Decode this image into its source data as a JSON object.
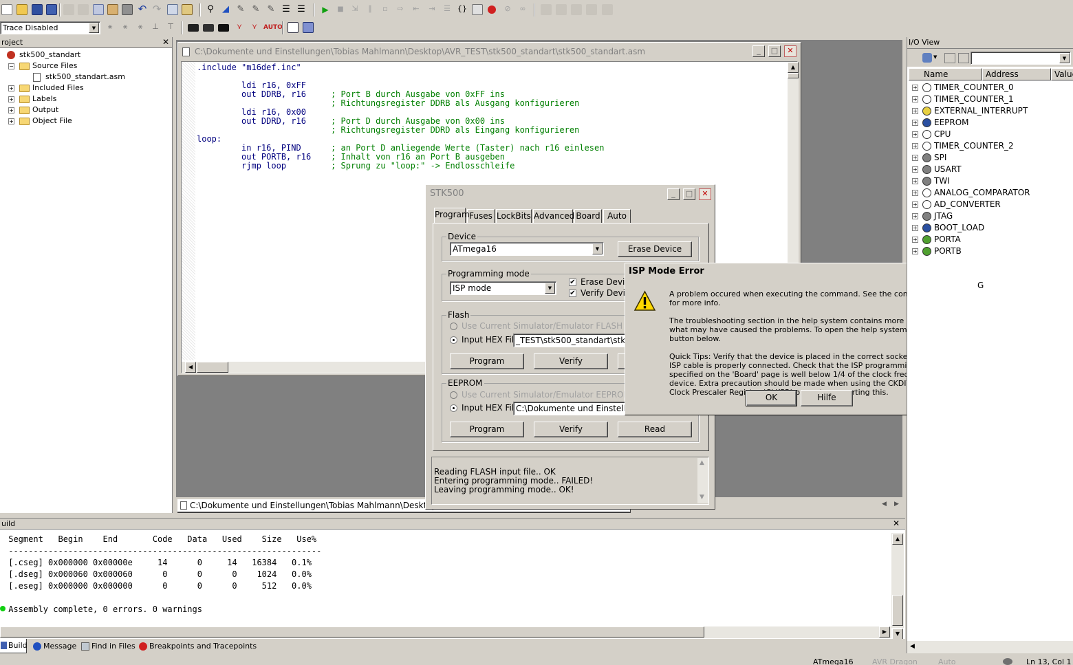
{
  "toolbar": {
    "trace_select": "Trace Disabled",
    "auto_label": "AUTO"
  },
  "project": {
    "header": "roject",
    "close": "✕",
    "root": "stk500_standart",
    "source_files": "Source Files",
    "asm_file": "stk500_standart.asm",
    "included_files": "Included Files",
    "labels": "Labels",
    "output": "Output",
    "object_file": "Object File"
  },
  "editor": {
    "title": "C:\\Dokumente und Einstellungen\\Tobias Mahlmann\\Desktop\\AVR_TEST\\stk500_standart\\stk500_standart.asm",
    "lines": [
      {
        "code": ".include \"m16def.inc\"",
        "comment": ""
      },
      {
        "code": "",
        "comment": ""
      },
      {
        "code": "         ldi r16, 0xFF",
        "comment": ""
      },
      {
        "code": "         out DDRB, r16     ",
        "comment": "; Port B durch Ausgabe von 0xFF ins"
      },
      {
        "code": "                           ",
        "comment": "; Richtungsregister DDRB als Ausgang konfigurieren"
      },
      {
        "code": "         ldi r16, 0x00",
        "comment": ""
      },
      {
        "code": "         out DDRD, r16     ",
        "comment": "; Port D durch Ausgabe von 0x00 ins"
      },
      {
        "code": "                           ",
        "comment": "; Richtungsregister DDRD als Eingang konfigurieren"
      },
      {
        "code": "loop:",
        "comment": ""
      },
      {
        "code": "         in r16, PIND      ",
        "comment": "; an Port D anliegende Werte (Taster) nach r16 einlesen"
      },
      {
        "code": "         out PORTB, r16    ",
        "comment": "; Inhalt von r16 an Port B ausgeben"
      },
      {
        "code": "         rjmp loop         ",
        "comment": "; Sprung zu \"loop:\" -> Endlosschleife"
      }
    ],
    "bottom_tab": "C:\\Dokumente und Einstellungen\\Tobias Mahlmann\\Desktop"
  },
  "stk500": {
    "title": "STK500",
    "tabs": [
      "Program",
      "Fuses",
      "LockBits",
      "Advanced",
      "Board",
      "Auto"
    ],
    "device_label": "Device",
    "device_value": "ATmega16",
    "erase_device": "Erase Device",
    "programming_mode_label": "Programming mode",
    "mode_value": "ISP mode",
    "erase_device_chk": "Erase Device",
    "verify_device_chk": "Verify Device",
    "flash_label": "Flash",
    "use_sim_flash": "Use Current Simulator/Emulator FLASH Memory",
    "input_hex": "Input HEX File",
    "flash_path": "_TEST\\stk500_standart\\stk500_",
    "program": "Program",
    "verify": "Verify",
    "eeprom_label": "EEPROM",
    "use_sim_eeprom": "Use Current Simulator/Emulator EEPROM Memory",
    "eeprom_path": "C:\\Dokumente und Einstellungen",
    "read": "Read",
    "log": [
      "Reading FLASH input file.. OK",
      "Entering programming mode.. FAILED!",
      "Leaving programming mode.. OK!"
    ]
  },
  "error_dialog": {
    "title": "ISP Mode Error",
    "close": "✕",
    "msg1": "A problem occured when executing the command. See the command output for more info.",
    "msg2": "The troubleshooting section in the help system contains more information on what may have caused the problems. To open the help system, click the Help button below.",
    "msg3": "Quick Tips: Verify that the device is placed in the correct socket, and that the ISP cable is properly connected. Check that the ISP programming frequency specified on the 'Board' page is well below 1/4 of the clock frequency of the device. Extra precaution should be made when using the CKDIV fuse and/or Clock Prescaler Register (CLKPR) on parts supporting this.",
    "ok": "OK",
    "help": "Hilfe"
  },
  "io_view": {
    "header": "I/O View",
    "col_name": "Name",
    "col_address": "Address",
    "col_value": "Value",
    "items": [
      "TIMER_COUNTER_0",
      "TIMER_COUNTER_1",
      "EXTERNAL_INTERRUPT",
      "EEPROM",
      "CPU",
      "TIMER_COUNTER_2",
      "SPI",
      "USART",
      "TWI",
      "ANALOG_COMPARATOR",
      "AD_CONVERTER",
      "JTAG",
      "BOOT_LOAD",
      "PORTA",
      "PORTB"
    ],
    "partial_g": "G"
  },
  "build": {
    "header": "uild",
    "close": "✕",
    "lines": [
      " Segment   Begin    End       Code   Data   Used    Size   Use%",
      " ---------------------------------------------------------------",
      " [.cseg] 0x000000 0x00000e     14      0     14   16384   0.1%",
      " [.dseg] 0x000060 0x000060      0      0      0    1024   0.0%",
      " [.eseg] 0x000000 0x000000      0      0      0     512   0.0%",
      "",
      " Assembly complete, 0 errors. 0 warnings"
    ],
    "tabs": [
      "Build",
      "Message",
      "Find in Files",
      "Breakpoints and Tracepoints"
    ]
  },
  "status": {
    "device": "ATmega16",
    "tool": "AVR Dragon",
    "mode": "Auto",
    "position": "Ln 13, Col 1"
  }
}
